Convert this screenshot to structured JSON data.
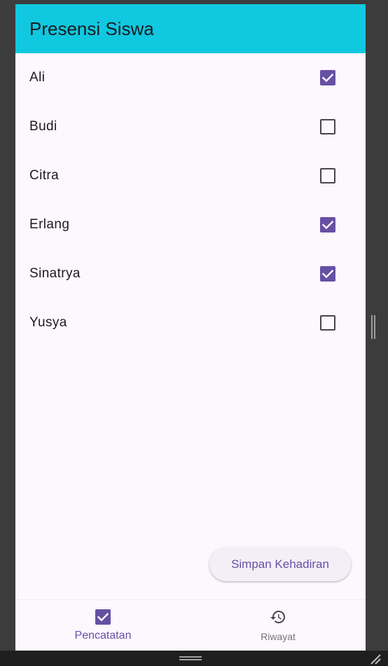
{
  "app_bar": {
    "title": "Presensi Siswa"
  },
  "students": [
    {
      "name": "Ali",
      "present": true
    },
    {
      "name": "Budi",
      "present": false
    },
    {
      "name": "Citra",
      "present": false
    },
    {
      "name": "Erlang",
      "present": true
    },
    {
      "name": "Sinatrya",
      "present": true
    },
    {
      "name": "Yusya",
      "present": false
    }
  ],
  "actions": {
    "save_label": "Simpan Kehadiran"
  },
  "bottom_nav": {
    "items": [
      {
        "label": "Pencatatan",
        "icon": "checkbox-icon",
        "active": true
      },
      {
        "label": "Riwayat",
        "icon": "history-icon",
        "active": false
      }
    ]
  },
  "colors": {
    "app_bar": "#10c8e0",
    "accent": "#6750a4",
    "background": "#fdf7fe",
    "frame": "#3c3c3c"
  }
}
